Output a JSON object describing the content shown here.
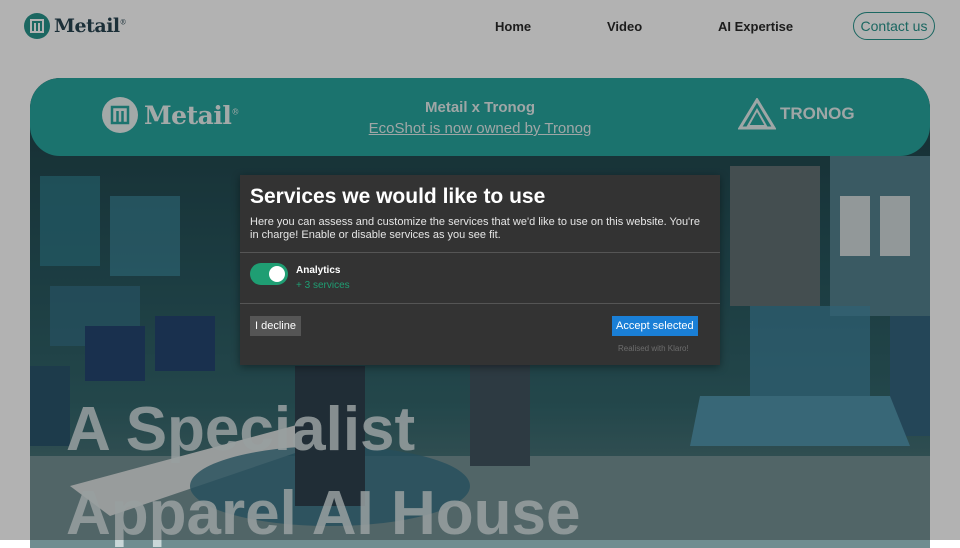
{
  "header": {
    "brand": "Metail",
    "brand_mark": "®",
    "nav": [
      {
        "label": "Home"
      },
      {
        "label": "Video"
      },
      {
        "label": "AI Expertise"
      }
    ],
    "contact_label": "Contact us"
  },
  "banner": {
    "brand": "Metail",
    "brand_mark": "®",
    "title": "Metail x Tronog",
    "link_text": "EcoShot is now owned by Tronog",
    "partner": "TRONOG"
  },
  "hero": {
    "headline_line1": "A Specialist",
    "headline_line2": "Apparel AI House"
  },
  "consent": {
    "title": "Services we would like to use",
    "description": "Here you can assess and customize the services that we'd like to use on this website. You're in charge! Enable or disable services as you see fit.",
    "service_label": "Analytics",
    "service_count": "+ 3 services",
    "service_enabled": true,
    "decline_label": "I decline",
    "accept_label": "Accept selected",
    "powered_by": "Realised with Klaro!"
  },
  "colors": {
    "brand_teal": "#1f8f87",
    "banner_teal": "#1fa19a",
    "modal_bg": "#333333",
    "toggle_on": "#1f9e73",
    "accept_blue": "#1a7fd6"
  },
  "icons": [
    "metail-logo-icon",
    "tronog-logo-icon",
    "toggle-switch-icon"
  ]
}
